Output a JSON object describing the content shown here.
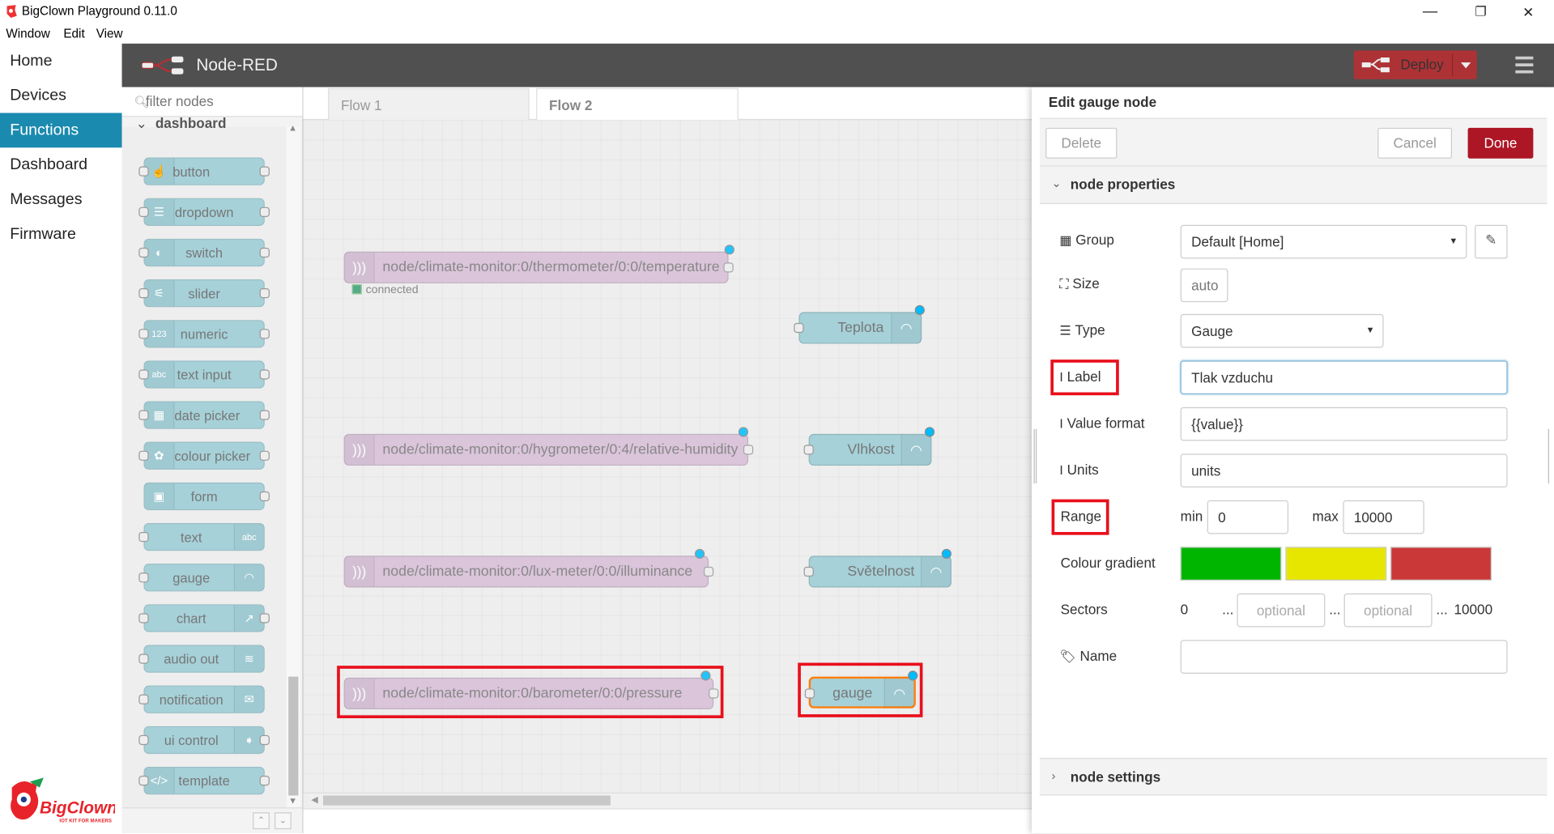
{
  "window": {
    "title": "BigClown Playground 0.11.0",
    "menu": [
      "Window",
      "Edit",
      "View"
    ],
    "controls": {
      "minimize": "—",
      "restore": "❐",
      "close": "✕"
    }
  },
  "appnav": {
    "items": [
      "Home",
      "Devices",
      "Functions",
      "Dashboard",
      "Messages",
      "Firmware"
    ],
    "active": "Functions",
    "logo_text": "BigClown",
    "logo_tag": "IOT KIT FOR MAKERS"
  },
  "header": {
    "brand": "Node-RED",
    "deploy_label": "Deploy",
    "deploy_color": "#ad3236"
  },
  "palette": {
    "filter_placeholder": "filter nodes",
    "category": "dashboard",
    "nodes": [
      {
        "label": "button",
        "icon": "hand-icon"
      },
      {
        "label": "dropdown",
        "icon": "list-icon"
      },
      {
        "label": "switch",
        "icon": "toggle-icon"
      },
      {
        "label": "slider",
        "icon": "sliders-icon"
      },
      {
        "label": "numeric",
        "icon": "numeric-icon"
      },
      {
        "label": "text input",
        "icon": "text-input-icon"
      },
      {
        "label": "date picker",
        "icon": "calendar-icon"
      },
      {
        "label": "colour picker",
        "icon": "palette-icon"
      },
      {
        "label": "form",
        "icon": "form-icon"
      },
      {
        "label": "text",
        "icon": "abc-icon"
      },
      {
        "label": "gauge",
        "icon": "gauge-icon"
      },
      {
        "label": "chart",
        "icon": "chart-icon"
      },
      {
        "label": "audio out",
        "icon": "audio-icon"
      },
      {
        "label": "notification",
        "icon": "envelope-icon"
      },
      {
        "label": "ui control",
        "icon": "arrow-icon"
      },
      {
        "label": "template",
        "icon": "code-icon"
      }
    ]
  },
  "workspace": {
    "tabs": [
      "Flow 1",
      "Flow 2"
    ],
    "active_tab": "Flow 2",
    "nodes": {
      "mqtt_temp": "node/climate-monitor:0/thermometer/0:0/temperature",
      "mqtt_temp_status": "connected",
      "gauge_temp": "Teplota",
      "mqtt_hum": "node/climate-monitor:0/hygrometer/0:4/relative-humidity",
      "gauge_hum": "Vlhkost",
      "mqtt_lux": "node/climate-monitor:0/lux-meter/0:0/illuminance",
      "gauge_lux": "Světelnost",
      "mqtt_press": "node/climate-monitor:0/barometer/0:0/pressure",
      "gauge_press": "gauge"
    }
  },
  "editor": {
    "title": "Edit gauge node",
    "delete": "Delete",
    "cancel": "Cancel",
    "done": "Done",
    "section_properties": "node properties",
    "section_settings": "node settings",
    "labels": {
      "group": "Group",
      "size": "Size",
      "type": "Type",
      "label": "Label",
      "value_format": "Value format",
      "units": "Units",
      "range": "Range",
      "min": "min",
      "max": "max",
      "colour_gradient": "Colour gradient",
      "sectors": "Sectors",
      "name": "Name"
    },
    "values": {
      "group": "Default [Home]",
      "size": "auto",
      "type": "Gauge",
      "label": "Tlak vzduchu",
      "value_format": "{{value}}",
      "units": "units",
      "min": "0",
      "max": "10000",
      "sectors_start": "0",
      "sectors_end": "10000",
      "sector_ph": "optional",
      "dots": "...",
      "name": ""
    },
    "gradient": [
      "#00b500",
      "#e6e600",
      "#ca3838"
    ]
  }
}
